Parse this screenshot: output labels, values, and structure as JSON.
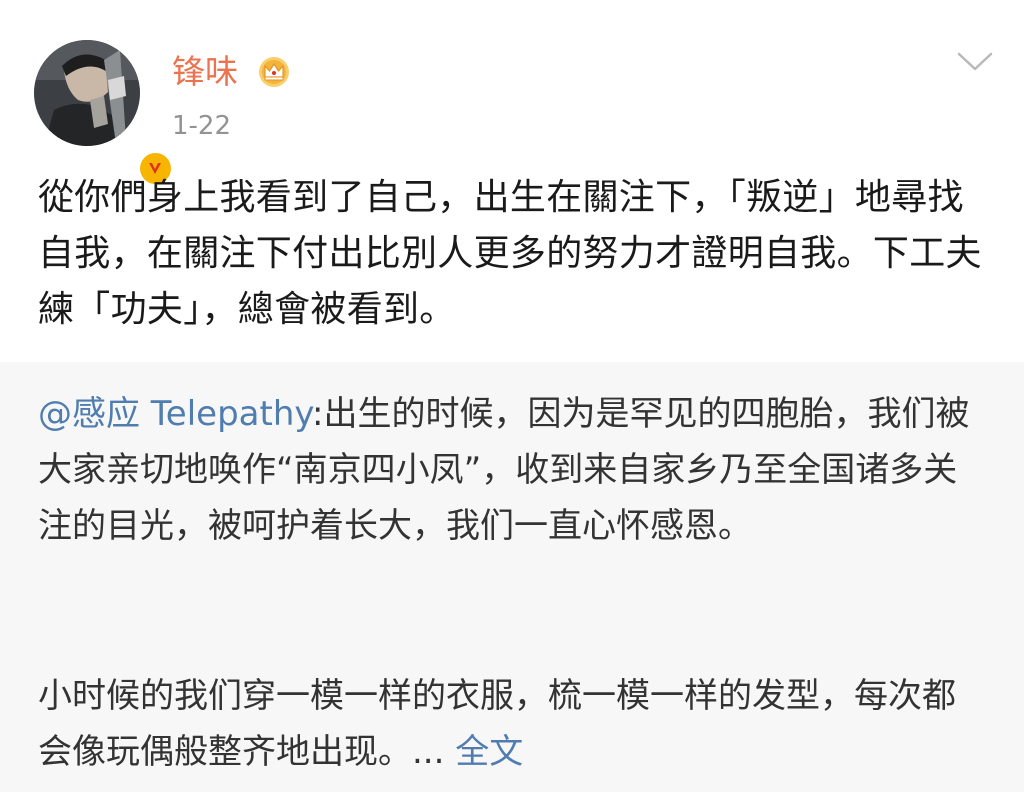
{
  "post": {
    "username": "锋味",
    "date": "1-22",
    "text": "從你們身上我看到了自己，出生在關注下，「叛逆」地尋找自我，在關注下付出比別人更多的努力才證明自我。下工夫練「功夫」，總會被看到。"
  },
  "repost": {
    "mention": "@感应 Telepathy",
    "text_part1": ":出生的时候，因为是罕见的四胞胎，我们被大家亲切地唤作“南京四小凤”，收到来自家乡乃至全国诸多关注的目光，被呵护着长大，我们一直心怀感恩。",
    "text_part2": "小时候的我们穿一模一样的衣服，梳一模一样的发型，每次都会像玩偶般整齐地出现。...",
    "more_label": "全文"
  },
  "icons": {
    "avatar": "avatar-photo",
    "verified": "verified-v-badge-icon",
    "member": "crown-icon",
    "menu": "chevron-down-icon"
  },
  "colors": {
    "username": "#eb7350",
    "link": "#507daf",
    "badge": "#f7b500",
    "repost_bg": "#f7f7f7"
  }
}
